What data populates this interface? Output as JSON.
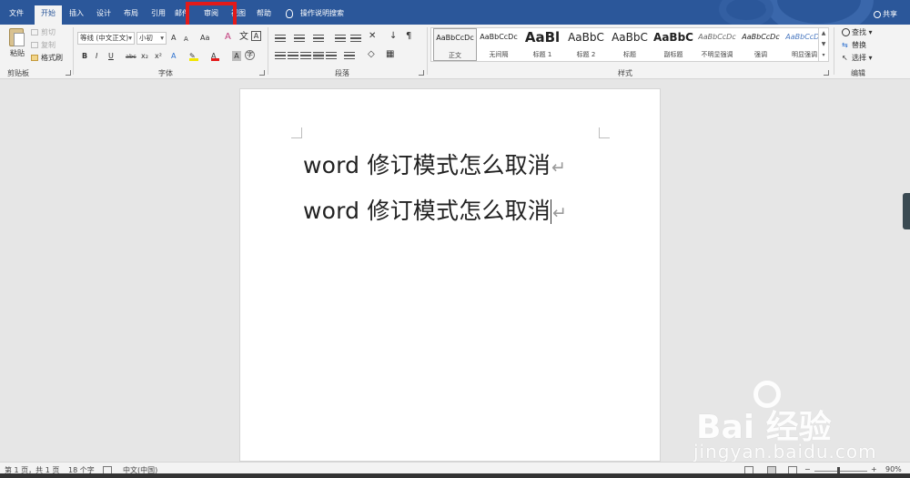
{
  "tabs": [
    "文件",
    "开始",
    "插入",
    "设计",
    "布局",
    "引用",
    "邮件",
    "审阅",
    "视图",
    "帮助"
  ],
  "active_tab_index": 1,
  "search_tab": "操作说明搜索",
  "share": "共享",
  "clipboard": {
    "paste": "粘贴",
    "cut": "剪切",
    "copy": "复制",
    "format_painter": "格式刷",
    "group_label": "剪贴板"
  },
  "font": {
    "family": "等线 (中文正文)",
    "size": "小初",
    "grow": "A",
    "shrink": "A",
    "case": "Aa",
    "bold": "B",
    "italic": "I",
    "underline": "U",
    "strike": "abc",
    "sub": "x₂",
    "sup": "x²",
    "group_label": "字体"
  },
  "paragraph": {
    "group_label": "段落"
  },
  "styles": {
    "items": [
      {
        "sample": "AaBbCcDc",
        "name": "正文"
      },
      {
        "sample": "AaBbCcDc",
        "name": "无间隔"
      },
      {
        "sample": "AaBl",
        "name": "标题 1"
      },
      {
        "sample": "AaBbC",
        "name": "标题 2"
      },
      {
        "sample": "AaBbC",
        "name": "标题"
      },
      {
        "sample": "AaBbC",
        "name": "副标题"
      },
      {
        "sample": "AaBbCcDc",
        "name": "不明显强调"
      },
      {
        "sample": "AaBbCcDc",
        "name": "强调"
      },
      {
        "sample": "AaBbCcDc",
        "name": "明显强调"
      }
    ],
    "group_label": "样式"
  },
  "editing": {
    "find": "查找",
    "replace": "替换",
    "select": "选择",
    "group_label": "编辑"
  },
  "document": {
    "lines": [
      "word 修订模式怎么取消",
      "word 修订模式怎么取消"
    ]
  },
  "statusbar": {
    "page": "第 1 页，共 1 页",
    "words": "18 个字",
    "language": "中文(中国)",
    "zoom": "90%"
  },
  "watermark": {
    "brand": "Bai 经验",
    "url": "jingyan.baidu.com"
  },
  "colors": {
    "ribbon_blue": "#2b579a",
    "highlight_red": "#e31a1a"
  }
}
